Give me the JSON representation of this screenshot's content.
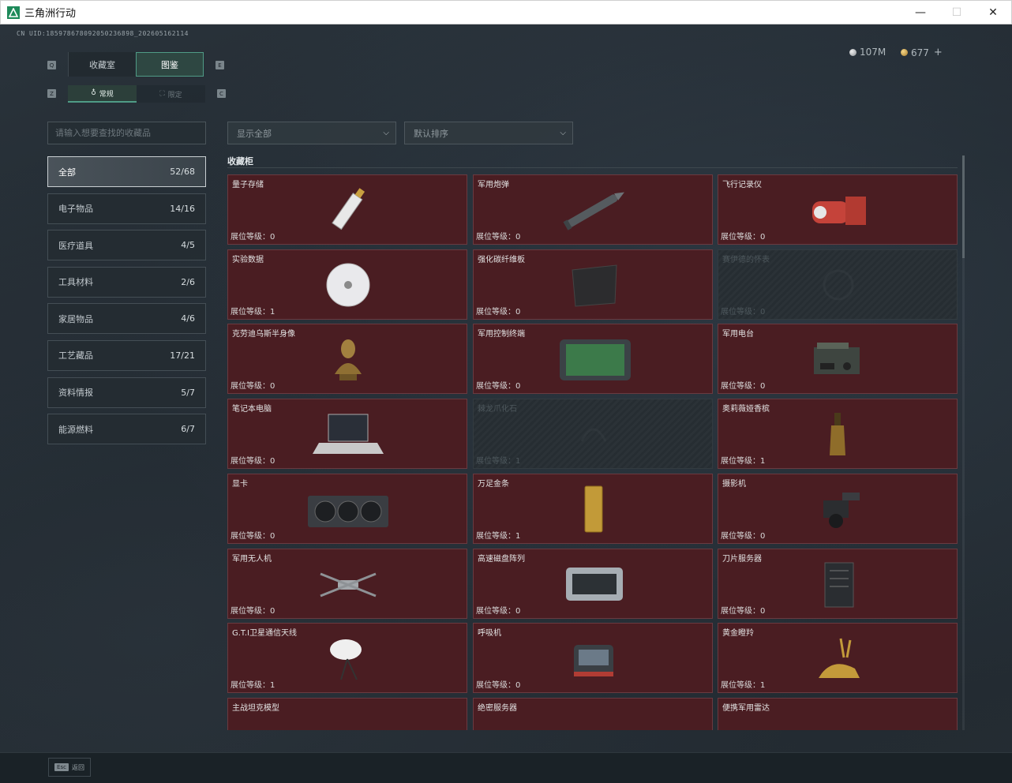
{
  "window": {
    "title": "三角洲行动",
    "minimize": "—",
    "maximize": "☐",
    "close": "✕"
  },
  "uid": "CN UID:18597867809205023689­8_202605162114",
  "currency": {
    "silver": "107M",
    "gold": "677",
    "add": "+"
  },
  "keyhints": {
    "q": "Q",
    "e": "E",
    "z": "Z",
    "c": "C"
  },
  "tabs": [
    {
      "label": "收藏室"
    },
    {
      "label": "图鉴"
    }
  ],
  "subtabs": [
    {
      "label": "常规",
      "icon": "♁"
    },
    {
      "label": "限定",
      "icon": "⛶"
    }
  ],
  "search": {
    "placeholder": "请输入想要查找的收藏品"
  },
  "categories": [
    {
      "label": "全部",
      "count": "52/68"
    },
    {
      "label": "电子物品",
      "count": "14/16"
    },
    {
      "label": "医疗道具",
      "count": "4/5"
    },
    {
      "label": "工具材料",
      "count": "2/6"
    },
    {
      "label": "家居物品",
      "count": "4/6"
    },
    {
      "label": "工艺藏品",
      "count": "17/21"
    },
    {
      "label": "资料情报",
      "count": "5/7"
    },
    {
      "label": "能源燃料",
      "count": "6/7"
    }
  ],
  "filter": {
    "label": "显示全部",
    "chevron": "⌵"
  },
  "sort": {
    "label": "默认排序",
    "chevron": "⌵"
  },
  "section": {
    "title": "收藏柜"
  },
  "level_prefix": "展位等级：",
  "items": [
    {
      "name": "量子存储",
      "level": "0",
      "icon": "usb-drive-icon",
      "locked": false
    },
    {
      "name": "军用炮弹",
      "level": "0",
      "icon": "artillery-shell-icon",
      "locked": false
    },
    {
      "name": "飞行记录仪",
      "level": "0",
      "icon": "flight-recorder-icon",
      "locked": false
    },
    {
      "name": "实验数据",
      "level": "1",
      "icon": "disc-icon",
      "locked": false
    },
    {
      "name": "强化碳纤维板",
      "level": "0",
      "icon": "carbon-plate-icon",
      "locked": false
    },
    {
      "name": "赛伊德的怀表",
      "level": "0",
      "icon": "pocket-watch-icon",
      "locked": true
    },
    {
      "name": "克劳迪乌斯半身像",
      "level": "0",
      "icon": "bust-icon",
      "locked": false
    },
    {
      "name": "军用控制终端",
      "level": "0",
      "icon": "terminal-icon",
      "locked": false
    },
    {
      "name": "军用电台",
      "level": "0",
      "icon": "radio-icon",
      "locked": false
    },
    {
      "name": "笔记本电脑",
      "level": "0",
      "icon": "laptop-icon",
      "locked": false
    },
    {
      "name": "棘龙爪化石",
      "level": "1",
      "icon": "fossil-icon",
      "locked": true
    },
    {
      "name": "奥莉薇娅香槟",
      "level": "1",
      "icon": "champagne-icon",
      "locked": false
    },
    {
      "name": "显卡",
      "level": "0",
      "icon": "gpu-icon",
      "locked": false
    },
    {
      "name": "万足金条",
      "level": "1",
      "icon": "gold-bar-icon",
      "locked": false
    },
    {
      "name": "摄影机",
      "level": "0",
      "icon": "camera-icon",
      "locked": false
    },
    {
      "name": "军用无人机",
      "level": "0",
      "icon": "drone-icon",
      "locked": false
    },
    {
      "name": "高速磁盘阵列",
      "level": "0",
      "icon": "disk-array-icon",
      "locked": false
    },
    {
      "name": "刀片服务器",
      "level": "0",
      "icon": "server-icon",
      "locked": false
    },
    {
      "name": "G.T.I卫星通信天线",
      "level": "1",
      "icon": "satellite-dish-icon",
      "locked": false
    },
    {
      "name": "呼吸机",
      "level": "0",
      "icon": "ventilator-icon",
      "locked": false
    },
    {
      "name": "黄金瞪羚",
      "level": "1",
      "icon": "gazelle-icon",
      "locked": false
    },
    {
      "name": "主战坦克模型",
      "level": "",
      "icon": "tank-icon",
      "locked": false
    },
    {
      "name": "绝密服务器",
      "level": "",
      "icon": "secret-server-icon",
      "locked": false
    },
    {
      "name": "便携军用雷达",
      "level": "",
      "icon": "radar-icon",
      "locked": false
    }
  ],
  "footer": {
    "esc_key": "Esc",
    "esc_label": "返回"
  }
}
